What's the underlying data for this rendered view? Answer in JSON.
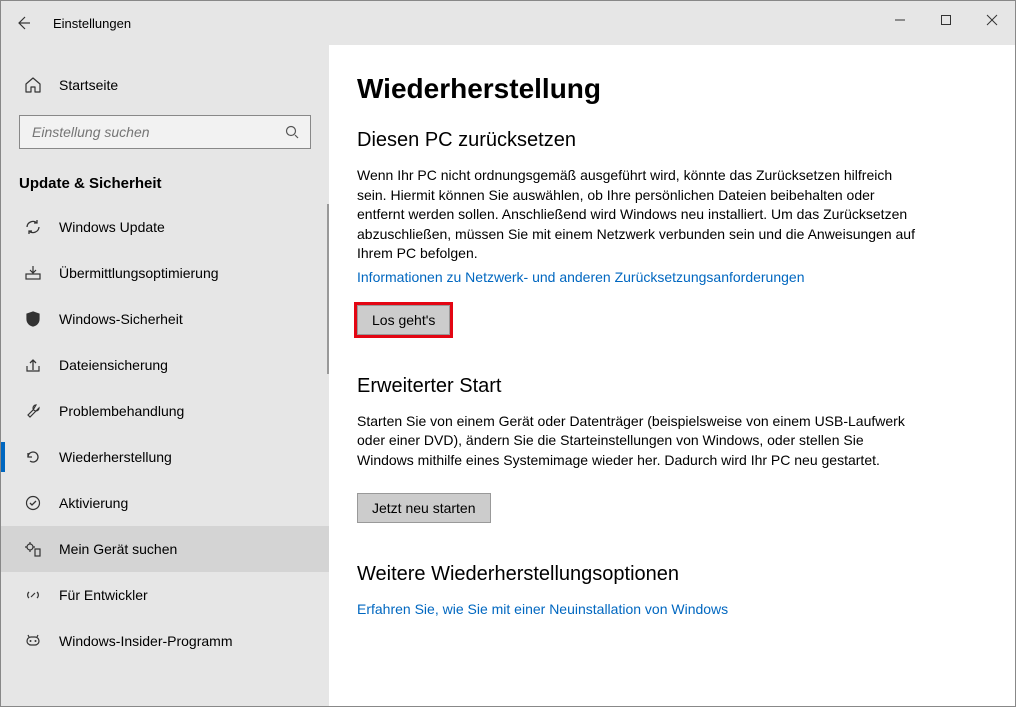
{
  "window": {
    "title": "Einstellungen"
  },
  "sidebar": {
    "home": "Startseite",
    "search_placeholder": "Einstellung suchen",
    "section": "Update & Sicherheit",
    "items": [
      {
        "label": "Windows Update"
      },
      {
        "label": "Übermittlungsoptimierung"
      },
      {
        "label": "Windows-Sicherheit"
      },
      {
        "label": "Dateiensicherung"
      },
      {
        "label": "Problembehandlung"
      },
      {
        "label": "Wiederherstellung"
      },
      {
        "label": "Aktivierung"
      },
      {
        "label": "Mein Gerät suchen"
      },
      {
        "label": "Für Entwickler"
      },
      {
        "label": "Windows-Insider-Programm"
      }
    ]
  },
  "main": {
    "title": "Wiederherstellung",
    "reset": {
      "heading": "Diesen PC zurücksetzen",
      "body": "Wenn Ihr PC nicht ordnungsgemäß ausgeführt wird, könnte das Zurücksetzen hilfreich sein. Hiermit können Sie auswählen, ob Ihre persönlichen Dateien beibehalten oder entfernt werden sollen. Anschließend wird Windows neu installiert. Um das Zurücksetzen abzuschließen, müssen Sie mit einem Netzwerk verbunden sein und die Anweisungen auf Ihrem PC befolgen.",
      "link": "Informationen zu Netzwerk- und anderen Zurücksetzungsanforderungen",
      "button": "Los geht's"
    },
    "advanced": {
      "heading": "Erweiterter Start",
      "body": "Starten Sie von einem Gerät oder Datenträger (beispielsweise von einem USB-Laufwerk oder einer DVD), ändern Sie die Starteinstellungen von Windows, oder stellen Sie Windows mithilfe eines Systemimage wieder her. Dadurch wird Ihr PC neu gestartet.",
      "button": "Jetzt neu starten"
    },
    "more": {
      "heading": "Weitere Wiederherstellungsoptionen",
      "link": "Erfahren Sie, wie Sie mit einer Neuinstallation von Windows"
    }
  }
}
